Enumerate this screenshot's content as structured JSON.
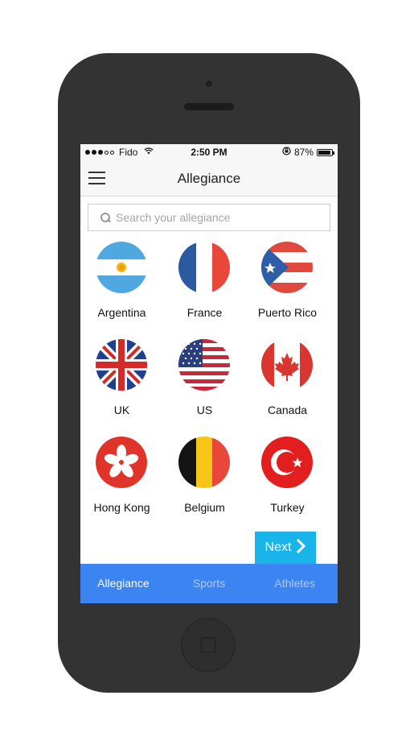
{
  "status_bar": {
    "signal_dots_filled": 3,
    "signal_dots_total": 5,
    "carrier": "Fido",
    "time": "2:50 PM",
    "battery_percent": "87%",
    "battery_level": 0.87
  },
  "navbar": {
    "title": "Allegiance",
    "menu_icon": "hamburger-icon"
  },
  "search": {
    "placeholder": "Search your allegiance",
    "value": "",
    "icon": "search-icon"
  },
  "countries": [
    {
      "label": "Argentina"
    },
    {
      "label": "France"
    },
    {
      "label": "Puerto Rico"
    },
    {
      "label": "UK"
    },
    {
      "label": "US"
    },
    {
      "label": "Canada"
    },
    {
      "label": "Hong Kong"
    },
    {
      "label": "Belgium"
    },
    {
      "label": "Turkey"
    }
  ],
  "next_button": {
    "label": "Next",
    "icon": "chevron-right-icon"
  },
  "tabs": [
    {
      "label": "Allegiance",
      "active": true
    },
    {
      "label": "Sports",
      "active": false
    },
    {
      "label": "Athletes",
      "active": false
    }
  ],
  "colors": {
    "tab_bar": "#3b84f1",
    "next_button": "#19b5ea",
    "phone_body": "#333333"
  }
}
